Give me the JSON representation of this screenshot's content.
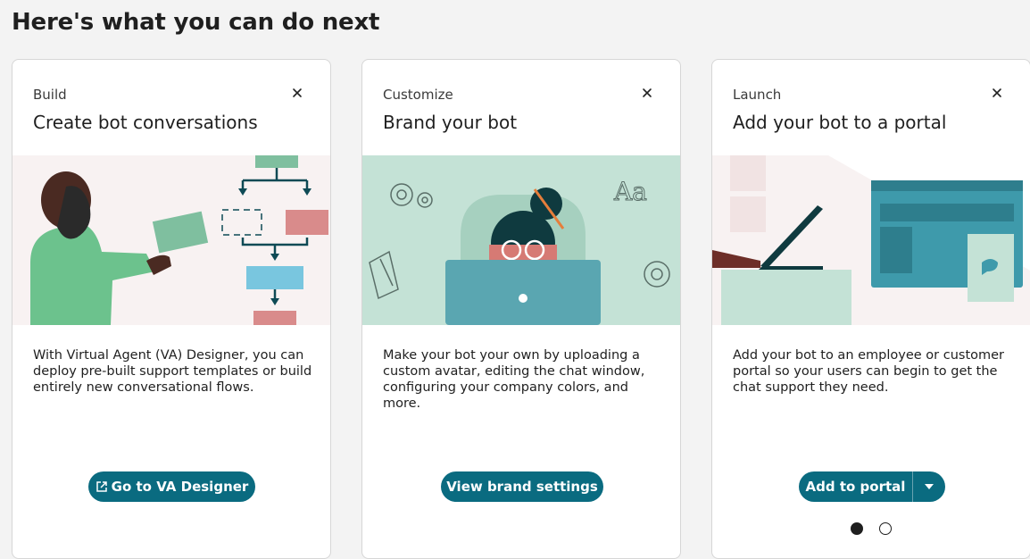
{
  "page": {
    "heading": "Here's what you can do next"
  },
  "cards": [
    {
      "eyebrow": "Build",
      "title": "Create bot conversations",
      "description": "With Virtual Agent (VA) Designer, you can deploy pre-built support templates or build entirely new conversational flows.",
      "button_label": "Go to VA Designer",
      "button_icon": "external-link-icon"
    },
    {
      "eyebrow": "Customize",
      "title": "Brand your bot",
      "description": "Make your bot your own by uploading a custom avatar, editing the chat window, configuring your company colors, and more.",
      "button_label": "View brand settings"
    },
    {
      "eyebrow": "Launch",
      "title": "Add your bot to a portal",
      "description": "Add your bot to an employee or customer portal so your users can begin to get the chat support they need.",
      "button_label": "Add to portal",
      "button_menu_icon": "caret-down-icon"
    }
  ],
  "pagination": {
    "total": 2,
    "active": 1
  },
  "colors": {
    "primary_button": "#0a6b80",
    "illustration_teal": "#c4e2d6",
    "illustration_pink": "#f8f2f2"
  },
  "icons": {
    "close": "close-icon"
  }
}
